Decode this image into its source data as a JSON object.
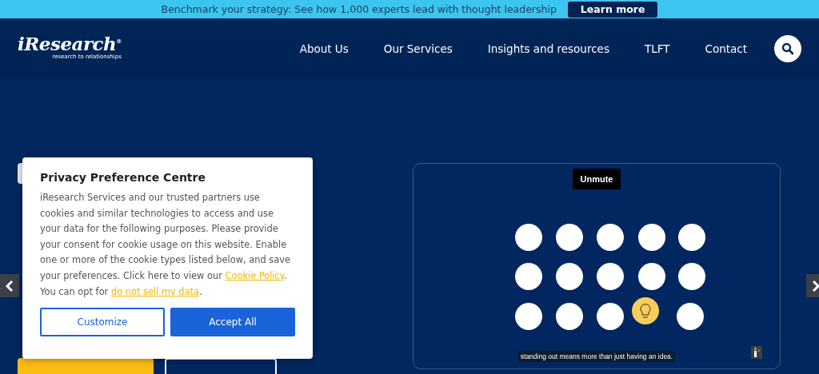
{
  "banner": {
    "text": "Benchmark your strategy: See how 1,000 experts lead with thought leadership",
    "button": "Learn more"
  },
  "header": {
    "logo": "iResearch",
    "logo_mark": "®",
    "tagline": "research to relationships",
    "nav": [
      "About Us",
      "Our Services",
      "Insights and resources",
      "TLFT",
      "Contact"
    ]
  },
  "video": {
    "button": "Unmute",
    "caption": "standing out means more than just having an idea."
  },
  "consent": {
    "title": "Privacy Preference Centre",
    "body": [
      {
        "kind": "text",
        "text": "iResearch Services and our trusted partners use cookies and similar technologies to access and use your data for the following purposes. Please provide your consent for cookie usage on this website. Enable one or more of the cookie types listed below, and save your preferences. Click here to view our "
      },
      {
        "kind": "link",
        "text": "Cookie Policy"
      },
      {
        "kind": "text",
        "text": ". You can opt for "
      },
      {
        "kind": "link",
        "text": "do not sell my data"
      },
      {
        "kind": "text",
        "text": "."
      }
    ],
    "buttons": [
      {
        "label": "Customize",
        "kind": "outline"
      },
      {
        "label": "Accept All",
        "kind": "primary"
      }
    ]
  }
}
